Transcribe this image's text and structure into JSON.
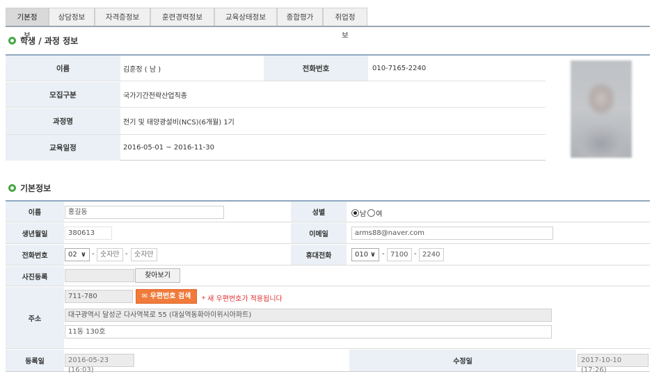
{
  "tabs": [
    "기본정보",
    "상담정보",
    "자격증정보",
    "훈련경력정보",
    "교육상태정보",
    "종합평가",
    "취업정보"
  ],
  "section1_title": "학생 / 과정 정보",
  "student": {
    "name_label": "이름",
    "name_value": "김훈정 ( 남 )",
    "phone_label": "전화번호",
    "phone_value": "010-7165-2240",
    "recruit_label": "모집구분",
    "recruit_value": "국가기간전략산업직종",
    "course_label": "과정명",
    "course_value": "전기 및 태양광설비(NCS)(6개월) 1기",
    "period_label": "교육일정",
    "period_value": "2016-05-01 ~ 2016-11-30"
  },
  "section2_title": "기본정보",
  "basic": {
    "name_label": "이름",
    "name_value": "홍길동",
    "gender_label": "성별",
    "gender_male": "남",
    "gender_female": "여",
    "birth_label": "생년월일",
    "birth_value": "380613",
    "email_label": "이메일",
    "email_value": "arms88@naver.com",
    "tel_label": "전화번호",
    "tel_area": "02",
    "tel_mid_placeholder": "숫자만",
    "tel_last_placeholder": "숫자만",
    "mobile_label": "휴대전화",
    "mobile_prefix": "010",
    "mobile_mid": "7100",
    "mobile_last": "2240",
    "photo_label": "사진등록",
    "find_button": "찾아보기",
    "address_label": "주소",
    "zipcode": "711-780",
    "zip_search_button": "우편번호 검색",
    "zip_warning": "* 새 우편번호가 적용됩니다",
    "address1": "대구광역시 달성군 다사역북로 55 (대실역동화아이위시아파트)",
    "address2": "11동 130호",
    "reg_label": "등록일",
    "reg_value": "2016-05-23 (16:03)",
    "mod_label": "수정일",
    "mod_value": "2017-10-10 (17:26)"
  },
  "colors": {
    "header_border": "#8fa7bf",
    "label_bg": "#eaf0f5",
    "accent_orange": "#f07b3a",
    "bullet_green": "#46a646",
    "warning_red": "#e03030"
  }
}
